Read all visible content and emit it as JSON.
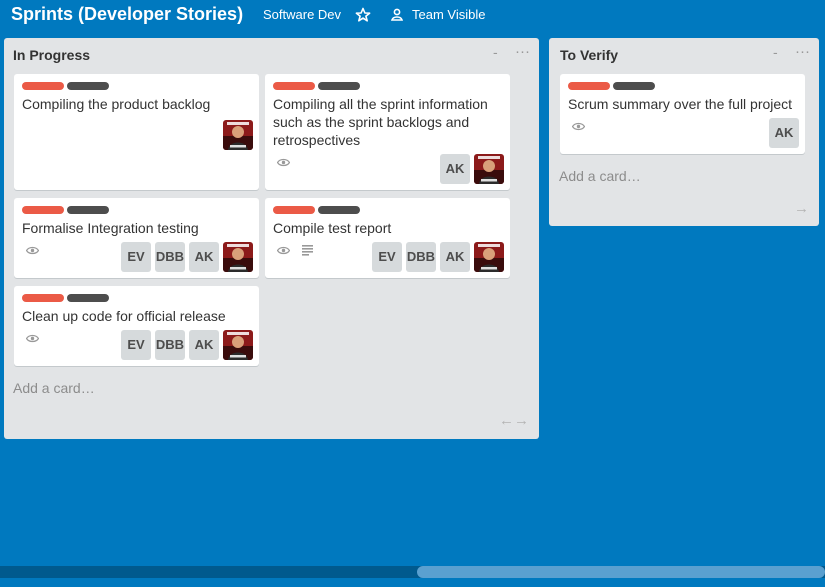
{
  "header": {
    "board_title": "Sprints (Developer Stories)",
    "team": "Software Dev",
    "star_icon": "star-icon",
    "visibility_icon": "team-visibility-icon",
    "visibility": "Team Visible"
  },
  "colors": {
    "board_background": "#0079bf",
    "list_background": "#e2e4e6",
    "label_red": "#eb5a46",
    "label_dark": "#4d4d4d"
  },
  "lists": [
    {
      "title": "In Progress",
      "minimize": "-",
      "menu": "···",
      "add_card": "Add a card…",
      "arrows": "←→",
      "cards": [
        {
          "title": "Compiling the product backlog",
          "members": [],
          "avatar": true
        },
        {
          "title_lines": [
            "Compiling all the sprint information",
            "such as the sprint backlogs and",
            "retrospectives"
          ],
          "members": [
            "AK"
          ],
          "watch": true,
          "avatar": true
        },
        {
          "title": "Formalise Integration testing",
          "members": [
            "EV",
            "DBB",
            "AK"
          ],
          "watch": true,
          "avatar": true
        },
        {
          "title": "Compile test report",
          "members": [
            "EV",
            "DBB",
            "AK"
          ],
          "watch": true,
          "description": true,
          "avatar": true
        },
        {
          "title": "Clean up code for official release",
          "members": [
            "EV",
            "DBB",
            "AK"
          ],
          "watch": true,
          "avatar": true
        }
      ]
    },
    {
      "title": "To Verify",
      "minimize": "-",
      "menu": "···",
      "add_card": "Add a card…",
      "arrows": "→",
      "cards": [
        {
          "title": "Scrum summary over the full project",
          "members": [
            "AK"
          ],
          "watch": true
        }
      ]
    }
  ]
}
